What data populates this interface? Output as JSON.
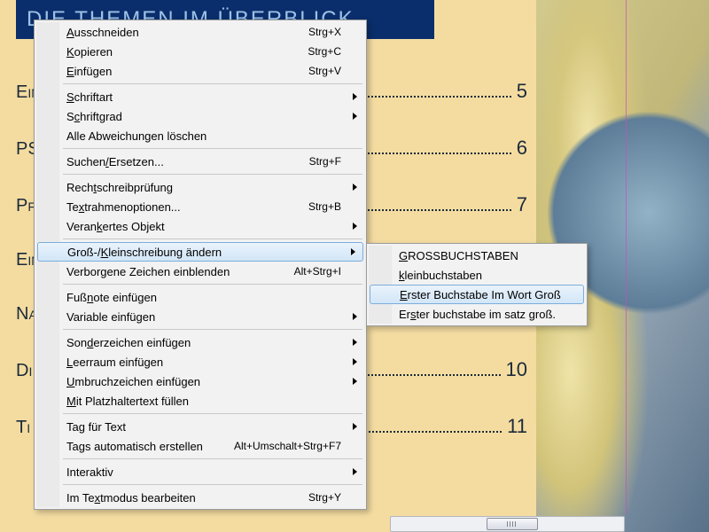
{
  "header": {
    "title": "DIE THEMEN IM ÜBERBLICK"
  },
  "toc": [
    {
      "label": "Ein",
      "page": "5"
    },
    {
      "label": "PS",
      "page": "6"
    },
    {
      "label": "Pf",
      "page": "7"
    },
    {
      "label": "Ein",
      "page": ""
    },
    {
      "label": "Na",
      "page": ""
    },
    {
      "label": "Di",
      "page": "10"
    },
    {
      "label": "Ti",
      "page": "11"
    }
  ],
  "menu": {
    "groups": [
      [
        {
          "label": "Ausschneiden",
          "mnemonic": "A",
          "shortcut": "Strg+X"
        },
        {
          "label": "Kopieren",
          "mnemonic": "K",
          "shortcut": "Strg+C"
        },
        {
          "label": "Einfügen",
          "mnemonic": "E",
          "shortcut": "Strg+V"
        }
      ],
      [
        {
          "label": "Schriftart",
          "mnemonic": "S",
          "submenu": true
        },
        {
          "label": "Schriftgrad",
          "mnemonic": "c",
          "submenu": true
        },
        {
          "label": "Alle Abweichungen löschen"
        }
      ],
      [
        {
          "label": "Suchen/Ersetzen...",
          "mnemonic": "/",
          "shortcut": "Strg+F"
        }
      ],
      [
        {
          "label": "Rechtschreibprüfung",
          "mnemonic": "t",
          "submenu": true
        },
        {
          "label": "Textrahmenoptionen...",
          "mnemonic": "x",
          "shortcut": "Strg+B"
        },
        {
          "label": "Verankertes Objekt",
          "mnemonic": "k",
          "submenu": true
        }
      ],
      [
        {
          "label": "Groß-/Kleinschreibung ändern",
          "mnemonic": "K",
          "submenu": true,
          "highlight": true
        },
        {
          "label": "Verborgene Zeichen einblenden",
          "shortcut": "Alt+Strg+I"
        }
      ],
      [
        {
          "label": "Fußnote einfügen",
          "mnemonic": "n"
        },
        {
          "label": "Variable einfügen",
          "submenu": true
        }
      ],
      [
        {
          "label": "Sonderzeichen einfügen",
          "mnemonic": "d",
          "submenu": true
        },
        {
          "label": "Leerraum einfügen",
          "mnemonic": "L",
          "submenu": true
        },
        {
          "label": "Umbruchzeichen einfügen",
          "mnemonic": "U",
          "submenu": true
        },
        {
          "label": "Mit Platzhaltertext füllen",
          "mnemonic": "M"
        }
      ],
      [
        {
          "label": "Tag für Text",
          "submenu": true
        },
        {
          "label": "Tags automatisch erstellen",
          "shortcut": "Alt+Umschalt+Strg+F7"
        }
      ],
      [
        {
          "label": "Interaktiv",
          "submenu": true
        }
      ],
      [
        {
          "label": "Im Textmodus bearbeiten",
          "mnemonic": "x",
          "shortcut": "Strg+Y"
        }
      ]
    ]
  },
  "submenu": {
    "items": [
      {
        "label": "GROSSBUCHSTABEN",
        "mnemonic": "G"
      },
      {
        "label": "kleinbuchstaben",
        "mnemonic": "k"
      },
      {
        "label": "Erster Buchstabe Im Wort Groß",
        "mnemonic": "E",
        "highlight": true
      },
      {
        "label": "Erster buchstabe im satz groß.",
        "mnemonic": "s"
      }
    ]
  }
}
